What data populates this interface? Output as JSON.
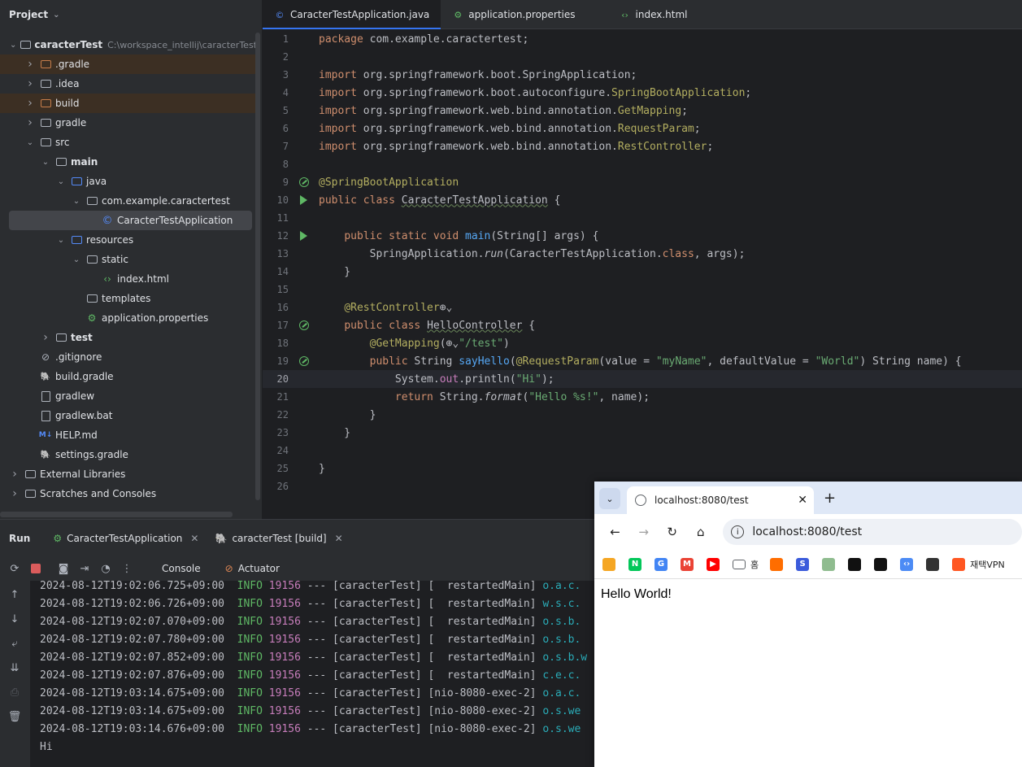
{
  "project": {
    "title": "Project",
    "tree": [
      {
        "label": "caracterTest",
        "path": "C:\\workspace_intellij\\caracterTest",
        "depth": 0,
        "open": true,
        "icon": "module-folder-icon",
        "bold": true
      },
      {
        "label": ".gradle",
        "depth": 1,
        "open": false,
        "icon": "folder-icon-orange",
        "excluded": true
      },
      {
        "label": ".idea",
        "depth": 1,
        "open": false,
        "icon": "folder-icon"
      },
      {
        "label": "build",
        "depth": 1,
        "open": false,
        "icon": "folder-icon-orange",
        "excluded": true
      },
      {
        "label": "gradle",
        "depth": 1,
        "open": false,
        "icon": "folder-icon"
      },
      {
        "label": "src",
        "depth": 1,
        "open": true,
        "icon": "folder-icon"
      },
      {
        "label": "main",
        "depth": 2,
        "open": true,
        "icon": "module-folder-icon",
        "bold": true
      },
      {
        "label": "java",
        "depth": 3,
        "open": true,
        "icon": "source-folder-icon"
      },
      {
        "label": "com.example.caractertest",
        "depth": 4,
        "open": true,
        "icon": "package-icon"
      },
      {
        "label": "CaracterTestApplication",
        "depth": 5,
        "icon": "spring-class-icon",
        "selected": true
      },
      {
        "label": "resources",
        "depth": 3,
        "open": true,
        "icon": "resources-folder-icon"
      },
      {
        "label": "static",
        "depth": 4,
        "open": true,
        "icon": "folder-icon"
      },
      {
        "label": "index.html",
        "depth": 5,
        "icon": "html-icon"
      },
      {
        "label": "templates",
        "depth": 4,
        "icon": "folder-icon"
      },
      {
        "label": "application.properties",
        "depth": 4,
        "icon": "properties-icon"
      },
      {
        "label": "test",
        "depth": 2,
        "open": false,
        "icon": "module-folder-icon",
        "bold": true
      },
      {
        "label": ".gitignore",
        "depth": 1,
        "icon": "ignore-file-icon"
      },
      {
        "label": "build.gradle",
        "depth": 1,
        "icon": "gradle-icon"
      },
      {
        "label": "gradlew",
        "depth": 1,
        "icon": "terminal-file-icon"
      },
      {
        "label": "gradlew.bat",
        "depth": 1,
        "icon": "text-file-icon"
      },
      {
        "label": "HELP.md",
        "depth": 1,
        "icon": "markdown-icon"
      },
      {
        "label": "settings.gradle",
        "depth": 1,
        "icon": "gradle-icon"
      },
      {
        "label": "External Libraries",
        "depth": 0,
        "open": false,
        "icon": "libraries-icon"
      },
      {
        "label": "Scratches and Consoles",
        "depth": 0,
        "open": false,
        "icon": "scratches-icon"
      }
    ]
  },
  "editor": {
    "tabs": [
      {
        "label": "CaracterTestApplication.java",
        "icon": "spring-class-icon",
        "active": true
      },
      {
        "label": "application.properties",
        "icon": "properties-icon"
      },
      {
        "label": "index.html",
        "icon": "html-icon"
      }
    ],
    "current_line": 20,
    "lines": [
      {
        "n": "1",
        "tokens": [
          [
            "kw",
            "package "
          ],
          [
            "",
            "com.example.caractertest;"
          ]
        ]
      },
      {
        "n": "2",
        "tokens": []
      },
      {
        "n": "3",
        "tokens": [
          [
            "kw",
            "import "
          ],
          [
            "",
            "org.springframework.boot.SpringApplication;"
          ]
        ]
      },
      {
        "n": "4",
        "tokens": [
          [
            "kw",
            "import "
          ],
          [
            "",
            "org.springframework.boot.autoconfigure."
          ],
          [
            "an",
            "SpringBootApplication"
          ],
          [
            "",
            ";"
          ]
        ]
      },
      {
        "n": "5",
        "tokens": [
          [
            "kw",
            "import "
          ],
          [
            "",
            "org.springframework.web.bind.annotation."
          ],
          [
            "an",
            "GetMapping"
          ],
          [
            "",
            ";"
          ]
        ]
      },
      {
        "n": "6",
        "tokens": [
          [
            "kw",
            "import "
          ],
          [
            "",
            "org.springframework.web.bind.annotation."
          ],
          [
            "an",
            "RequestParam"
          ],
          [
            "",
            ";"
          ]
        ]
      },
      {
        "n": "7",
        "tokens": [
          [
            "kw",
            "import "
          ],
          [
            "",
            "org.springframework.web.bind.annotation."
          ],
          [
            "an",
            "RestController"
          ],
          [
            "",
            ";"
          ]
        ]
      },
      {
        "n": "8",
        "tokens": []
      },
      {
        "n": "9",
        "gutter": "bean",
        "tokens": [
          [
            "an",
            "@SpringBootApplication"
          ]
        ]
      },
      {
        "n": "10",
        "gutter": "run",
        "tokens": [
          [
            "kw",
            "public class "
          ],
          [
            "under",
            "CaracterTestApplication"
          ],
          [
            "",
            " {"
          ]
        ]
      },
      {
        "n": "11",
        "tokens": []
      },
      {
        "n": "12",
        "gutter": "run",
        "tokens": [
          [
            "",
            "    "
          ],
          [
            "kw",
            "public static void "
          ],
          [
            "fn",
            "main"
          ],
          [
            "",
            "(String[] args) {"
          ]
        ]
      },
      {
        "n": "13",
        "tokens": [
          [
            "",
            "        SpringApplication."
          ],
          [
            "it",
            "run"
          ],
          [
            "",
            "(CaracterTestApplication."
          ],
          [
            "kw",
            "class"
          ],
          [
            "",
            ", args);"
          ]
        ]
      },
      {
        "n": "14",
        "tokens": [
          [
            "",
            "    }"
          ]
        ]
      },
      {
        "n": "15",
        "tokens": []
      },
      {
        "n": "16",
        "tokens": [
          [
            "",
            "    "
          ],
          [
            "an",
            "@RestController"
          ],
          [
            "",
            "⊕⌄"
          ]
        ]
      },
      {
        "n": "17",
        "gutter": "bean",
        "tokens": [
          [
            "",
            "    "
          ],
          [
            "kw",
            "public class "
          ],
          [
            "under",
            "HelloController"
          ],
          [
            "",
            " {"
          ]
        ]
      },
      {
        "n": "18",
        "tokens": [
          [
            "",
            "        "
          ],
          [
            "an",
            "@GetMapping"
          ],
          [
            "",
            "(⊕⌄"
          ],
          [
            "st",
            "\"/test\""
          ],
          [
            "",
            ")"
          ]
        ]
      },
      {
        "n": "19",
        "gutter": "bean",
        "tokens": [
          [
            "",
            "        "
          ],
          [
            "kw",
            "public "
          ],
          [
            "",
            "String "
          ],
          [
            "fn",
            "sayHello"
          ],
          [
            "",
            "("
          ],
          [
            "an",
            "@RequestParam"
          ],
          [
            "",
            "(value = "
          ],
          [
            "st",
            "\"myName\""
          ],
          [
            "",
            ", defaultValue = "
          ],
          [
            "st",
            "\"World\""
          ],
          [
            "",
            ") String name) {"
          ]
        ]
      },
      {
        "n": "20",
        "tokens": [
          [
            "",
            "            System."
          ],
          [
            "pu",
            "out"
          ],
          [
            "",
            ".println("
          ],
          [
            "st",
            "\"Hi\""
          ],
          [
            "",
            ");"
          ]
        ]
      },
      {
        "n": "21",
        "tokens": [
          [
            "",
            "            "
          ],
          [
            "kw",
            "return "
          ],
          [
            "",
            "String."
          ],
          [
            "it",
            "format"
          ],
          [
            "",
            "("
          ],
          [
            "st",
            "\"Hello %s!\""
          ],
          [
            "",
            ", name);"
          ]
        ]
      },
      {
        "n": "22",
        "tokens": [
          [
            "",
            "        }"
          ]
        ]
      },
      {
        "n": "23",
        "tokens": [
          [
            "",
            "    }"
          ]
        ]
      },
      {
        "n": "24",
        "tokens": []
      },
      {
        "n": "25",
        "tokens": [
          [
            "",
            "}"
          ]
        ]
      },
      {
        "n": "26",
        "tokens": []
      }
    ]
  },
  "run": {
    "title": "Run",
    "tabs": [
      {
        "label": "CaracterTestApplication",
        "icon": "spring-run-icon"
      },
      {
        "label": "caracterTest [build]",
        "icon": "gradle-icon"
      }
    ],
    "toolbar": {
      "console": "Console",
      "actuator": "Actuator"
    },
    "log": [
      {
        "ts": "2024-08-12T19:02:06.725+09:00",
        "level": "INFO",
        "pid": "19156",
        "app": "--- [caracterTest] [  restartedMain]",
        "cls": "o.a.c."
      },
      {
        "ts": "2024-08-12T19:02:06.726+09:00",
        "level": "INFO",
        "pid": "19156",
        "app": "--- [caracterTest] [  restartedMain]",
        "cls": "w.s.c."
      },
      {
        "ts": "2024-08-12T19:02:07.070+09:00",
        "level": "INFO",
        "pid": "19156",
        "app": "--- [caracterTest] [  restartedMain]",
        "cls": "o.s.b."
      },
      {
        "ts": "2024-08-12T19:02:07.780+09:00",
        "level": "INFO",
        "pid": "19156",
        "app": "--- [caracterTest] [  restartedMain]",
        "cls": "o.s.b."
      },
      {
        "ts": "2024-08-12T19:02:07.852+09:00",
        "level": "INFO",
        "pid": "19156",
        "app": "--- [caracterTest] [  restartedMain]",
        "cls": "o.s.b.w"
      },
      {
        "ts": "2024-08-12T19:02:07.876+09:00",
        "level": "INFO",
        "pid": "19156",
        "app": "--- [caracterTest] [  restartedMain]",
        "cls": "c.e.c."
      },
      {
        "ts": "2024-08-12T19:03:14.675+09:00",
        "level": "INFO",
        "pid": "19156",
        "app": "--- [caracterTest] [nio-8080-exec-2]",
        "cls": "o.a.c."
      },
      {
        "ts": "2024-08-12T19:03:14.675+09:00",
        "level": "INFO",
        "pid": "19156",
        "app": "--- [caracterTest] [nio-8080-exec-2]",
        "cls": "o.s.we"
      },
      {
        "ts": "2024-08-12T19:03:14.676+09:00",
        "level": "INFO",
        "pid": "19156",
        "app": "--- [caracterTest] [nio-8080-exec-2]",
        "cls": "o.s.we"
      }
    ],
    "output": "Hi"
  },
  "browser": {
    "tab_title": "localhost:8080/test",
    "url": "localhost:8080/test",
    "bookmarks": [
      {
        "icon": "weather-icon",
        "color": "#f5a623"
      },
      {
        "icon": "naver-icon",
        "color": "#03c75a",
        "glyph": "N"
      },
      {
        "icon": "google-icon",
        "color": "#4285f4",
        "glyph": "G"
      },
      {
        "icon": "gmail-icon",
        "color": "#ea4335",
        "glyph": "M"
      },
      {
        "icon": "youtube-icon",
        "color": "#ff0000",
        "glyph": "▶"
      },
      {
        "icon": "folder-bookmark-icon",
        "color": "#5f6368",
        "label": "홈"
      },
      {
        "icon": "app-icon",
        "color": "#ff6d00"
      },
      {
        "icon": "s-icon",
        "color": "#3b5bdb",
        "glyph": "S"
      },
      {
        "icon": "avatar-icon",
        "color": "#8fbc8f"
      },
      {
        "icon": "notion-icon",
        "color": "#111111"
      },
      {
        "icon": "github-icon",
        "color": "#111111"
      },
      {
        "icon": "dev-icon",
        "color": "#4c8bf5",
        "glyph": "‹›"
      },
      {
        "icon": "chatgpt-icon",
        "color": "#333333"
      },
      {
        "icon": "vpn-icon",
        "color": "#ff5722",
        "label": "재택VPN"
      }
    ],
    "content": "Hello World!"
  }
}
